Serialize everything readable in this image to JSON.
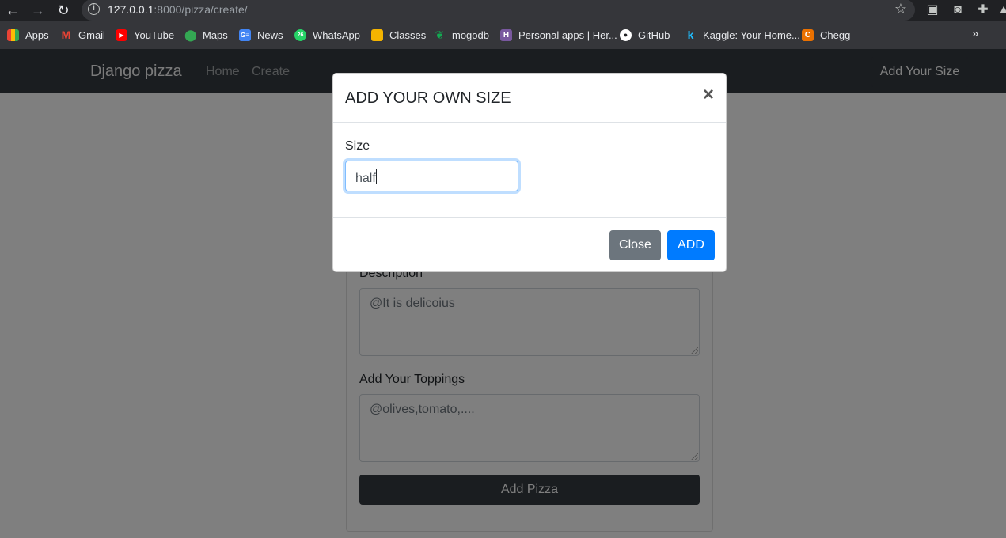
{
  "browser": {
    "url_host": "127.0.0.1",
    "url_rest": ":8000/pizza/create/",
    "bookmarks": [
      {
        "label": "Apps",
        "icon": "apps-grid-icon",
        "color": "#ea4335"
      },
      {
        "label": "Gmail",
        "icon": "gmail-icon",
        "color": "#ea4335"
      },
      {
        "label": "YouTube",
        "icon": "youtube-icon",
        "color": "#ff0000"
      },
      {
        "label": "Maps",
        "icon": "maps-pin-icon",
        "color": "#34a853"
      },
      {
        "label": "News",
        "icon": "google-news-icon",
        "color": "#4285f4"
      },
      {
        "label": "WhatsApp",
        "icon": "whatsapp-icon",
        "color": "#25d366"
      },
      {
        "label": "Classes",
        "icon": "classroom-icon",
        "color": "#f4b400"
      },
      {
        "label": "mogodb",
        "icon": "mongodb-leaf-icon",
        "color": "#13aa52"
      },
      {
        "label": "Personal apps | Her...",
        "icon": "heroku-icon",
        "color": "#79589f"
      },
      {
        "label": "GitHub",
        "icon": "github-icon",
        "color": "#ffffff"
      },
      {
        "label": "Kaggle: Your Home...",
        "icon": "kaggle-icon",
        "color": "#20beff"
      },
      {
        "label": "Chegg",
        "icon": "chegg-icon",
        "color": "#eb7100"
      }
    ]
  },
  "navbar": {
    "brand": "Django pizza",
    "links": [
      "Home",
      "Create"
    ],
    "add_size_button": "Add Your Size"
  },
  "form": {
    "description_label": "Description",
    "description_placeholder": "@It is delicoius",
    "toppings_label": "Add Your Toppings",
    "toppings_placeholder": "@olives,tomato,....",
    "submit_label": "Add Pizza"
  },
  "modal": {
    "title": "ADD YOUR OWN SIZE",
    "close_symbol": "×",
    "size_label": "Size",
    "size_value": "half",
    "close_button": "Close",
    "add_button": "ADD"
  },
  "colors": {
    "navbar": "#343a40",
    "primary": "#007bff",
    "secondary": "#6c757d"
  }
}
